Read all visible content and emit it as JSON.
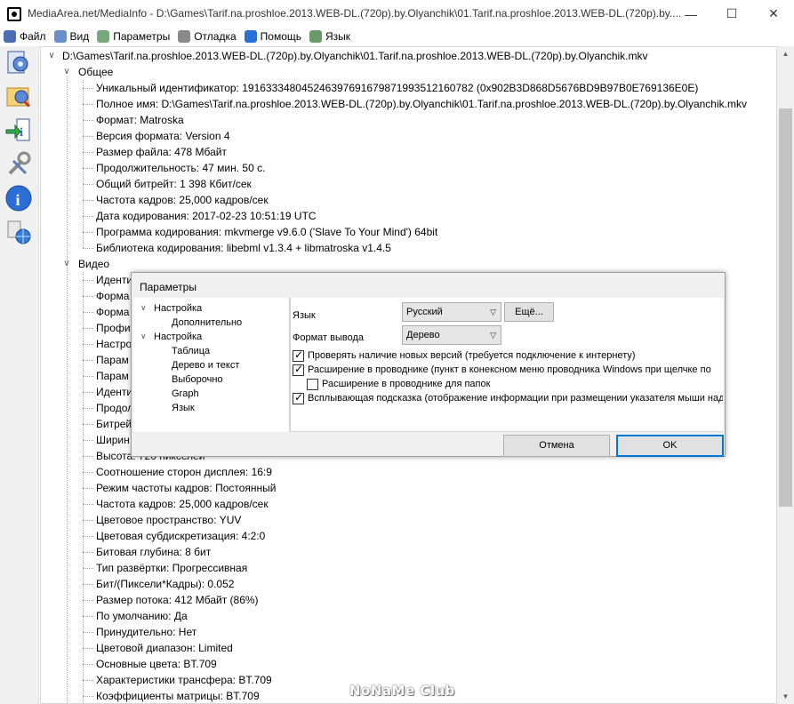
{
  "window": {
    "title": "MediaArea.net/MediaInfo - D:\\Games\\Tarif.na.proshloe.2013.WEB-DL.(720p).by.Olyanchik\\01.Tarif.na.proshloe.2013.WEB-DL.(720p).by....",
    "minimize": "—",
    "maximize": "☐",
    "close": "✕"
  },
  "menu": [
    {
      "label": "Файл",
      "icon": "file-icon",
      "color": "#4a6fb5"
    },
    {
      "label": "Вид",
      "icon": "view-icon",
      "color": "#6a8fc8"
    },
    {
      "label": "Параметры",
      "icon": "options-icon",
      "color": "#7aa87a"
    },
    {
      "label": "Отладка",
      "icon": "debug-icon",
      "color": "#8a8a8a"
    },
    {
      "label": "Помощь",
      "icon": "help-icon",
      "color": "#2b6fd6"
    },
    {
      "label": "Язык",
      "icon": "language-icon",
      "color": "#6a9a6a"
    }
  ],
  "toolbar": [
    {
      "icon": "open-file-icon"
    },
    {
      "icon": "open-folder-icon"
    },
    {
      "icon": "export-icon"
    },
    {
      "icon": "preferences-icon"
    },
    {
      "icon": "about-icon"
    },
    {
      "icon": "web-icon"
    }
  ],
  "tree": {
    "root": "D:\\Games\\Tarif.na.proshloe.2013.WEB-DL.(720p).by.Olyanchik\\01.Tarif.na.proshloe.2013.WEB-DL.(720p).by.Olyanchik.mkv",
    "general_header": "Общее",
    "general": [
      "Уникальный идентификатор: 191633348045246397691679871993512160782 (0x902B3D868D5676BD9B97B0E769136E0E)",
      "Полное имя: D:\\Games\\Tarif.na.proshloe.2013.WEB-DL.(720p).by.Olyanchik\\01.Tarif.na.proshloe.2013.WEB-DL.(720p).by.Olyanchik.mkv",
      "Формат: Matroska",
      "Версия формата: Version 4",
      "Размер файла: 478 Мбайт",
      "Продолжительность: 47 мин. 50 с.",
      "Общий битрейт: 1 398 Кбит/сек",
      "Частота кадров: 25,000 кадров/сек",
      "Дата кодирования: 2017-02-23 10:51:19 UTC",
      "Программа кодирования: mkvmerge v9.6.0 ('Slave To Your Mind') 64bit",
      "Библиотека кодирования: libebml v1.3.4 + libmatroska v1.4.5"
    ],
    "video_header": "Видео",
    "video": [
      "Иденти",
      "Форма",
      "Форма",
      "Профи",
      "Настро",
      "Парам",
      "Парам",
      "Иденти",
      "Продол",
      "Битрей",
      "Ширин",
      "Высота: 720 пикселей",
      "Соотношение сторон дисплея: 16:9",
      "Режим частоты кадров: Постоянный",
      "Частота кадров: 25,000 кадров/сек",
      "Цветовое пространство: YUV",
      "Цветовая субдискретизация: 4:2:0",
      "Битовая глубина: 8 бит",
      "Тип развёртки: Прогрессивная",
      "Бит/(Пиксели*Кадры): 0.052",
      "Размер потока: 412 Мбайт (86%)",
      "По умолчанию: Да",
      "Принудительно: Нет",
      "Цветовой диапазон: Limited",
      "Основные цвета: BT.709",
      "Характеристики трансфера: BT.709",
      "Коэффициенты матрицы: BT.709"
    ]
  },
  "dialog": {
    "title": "Параметры",
    "tree": [
      {
        "label": "Настройка",
        "level": 0,
        "expander": "∨"
      },
      {
        "label": "Дополнительно",
        "level": 1
      },
      {
        "label": "Настройка",
        "level": 0,
        "expander": "∨"
      },
      {
        "label": "Таблица",
        "level": 1
      },
      {
        "label": "Дерево и текст",
        "level": 1
      },
      {
        "label": "Выборочно",
        "level": 1
      },
      {
        "label": "Graph",
        "level": 1
      },
      {
        "label": "Язык",
        "level": 1
      }
    ],
    "language_label": "Язык",
    "language_value": "Русский",
    "more_button": "Ещё...",
    "output_label": "Формат вывода",
    "output_value": "Дерево",
    "checkboxes": [
      {
        "label": "Проверять наличие новых версий (требуется подключение к интернету)",
        "checked": true
      },
      {
        "label": "Расширение в проводнике (пункт в конексном меню проводника Windows при щелчке по",
        "checked": true
      },
      {
        "label": "Расширение в проводнике для папок",
        "checked": false
      },
      {
        "label": "Всплывающая подсказка (отображение информации при размещении указателя мыши над",
        "checked": true
      }
    ],
    "cancel": "Отмена",
    "ok": "OK"
  },
  "watermark": "NoNaMe Club"
}
